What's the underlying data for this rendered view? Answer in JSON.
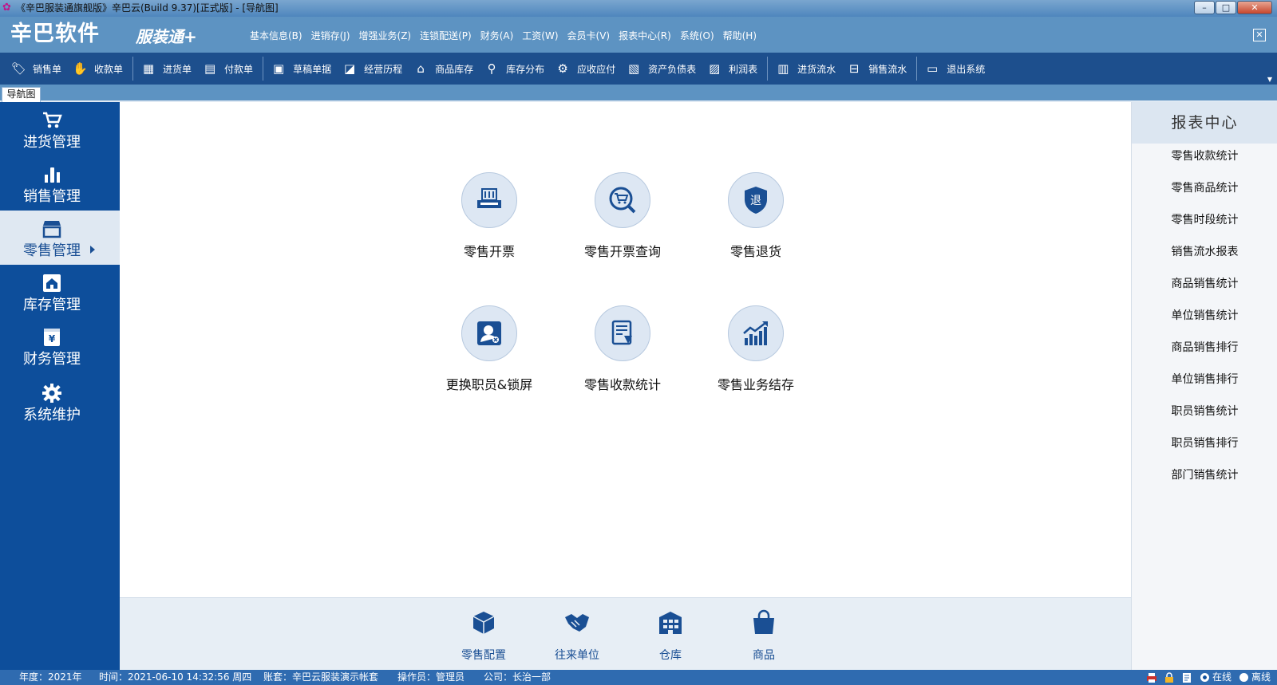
{
  "window": {
    "title": "《辛巴服装通旗舰版》辛巴云(Build 9.37)[正式版] - [导航图]",
    "buttons": {
      "minimize": "–",
      "maximize": "□",
      "close": "✕"
    }
  },
  "brand": {
    "logo": "辛巴软件",
    "product": "服装通+",
    "close": "✕"
  },
  "menu": [
    "基本信息(B)",
    "进销存(J)",
    "增强业务(Z)",
    "连锁配送(P)",
    "财务(A)",
    "工资(W)",
    "会员卡(V)",
    "报表中心(R)",
    "系统(O)",
    "帮助(H)"
  ],
  "toolbar": [
    {
      "label": "销售单",
      "icon": "tag-icon"
    },
    {
      "label": "收款单",
      "icon": "receive-money-icon"
    },
    {
      "label": "进货单",
      "icon": "calendar-icon"
    },
    {
      "label": "付款单",
      "icon": "payment-icon"
    },
    {
      "label": "草稿单据",
      "icon": "clipboard-icon"
    },
    {
      "label": "经营历程",
      "icon": "chart-line-icon"
    },
    {
      "label": "商品库存",
      "icon": "store-icon"
    },
    {
      "label": "库存分布",
      "icon": "map-pin-icon"
    },
    {
      "label": "应收应付",
      "icon": "settlement-icon"
    },
    {
      "label": "资产负债表",
      "icon": "balance-sheet-icon"
    },
    {
      "label": "利润表",
      "icon": "profit-icon"
    },
    {
      "label": "进货流水",
      "icon": "document-icon"
    },
    {
      "label": "销售流水",
      "icon": "basket-icon"
    },
    {
      "label": "退出系统",
      "icon": "monitor-icon"
    }
  ],
  "tabs": [
    {
      "label": "导航图"
    }
  ],
  "sidebar": [
    {
      "label": "进货管理",
      "icon": "cart-icon",
      "active": false
    },
    {
      "label": "销售管理",
      "icon": "bar-chart-icon",
      "active": false
    },
    {
      "label": "零售管理",
      "icon": "storefront-icon",
      "active": true
    },
    {
      "label": "库存管理",
      "icon": "warehouse-icon",
      "active": false
    },
    {
      "label": "财务管理",
      "icon": "yen-icon",
      "active": false
    },
    {
      "label": "系统维护",
      "icon": "gear-icon",
      "active": false
    }
  ],
  "functions": [
    {
      "label": "零售开票",
      "icon": "cash-register-icon"
    },
    {
      "label": "零售开票查询",
      "icon": "cart-search-icon"
    },
    {
      "label": "零售退货",
      "icon": "return-shield-icon"
    },
    {
      "label": "更换职员&锁屏",
      "icon": "user-switch-icon"
    },
    {
      "label": "零售收款统计",
      "icon": "report-icon"
    },
    {
      "label": "零售业务结存",
      "icon": "growth-chart-icon"
    }
  ],
  "quick": [
    {
      "label": "零售配置",
      "icon": "box-icon"
    },
    {
      "label": "往来单位",
      "icon": "handshake-icon"
    },
    {
      "label": "仓库",
      "icon": "warehouse-building-icon"
    },
    {
      "label": "商品",
      "icon": "shopping-bag-icon"
    }
  ],
  "report_center": {
    "title": "报表中心",
    "links": [
      "零售收款统计",
      "零售商品统计",
      "零售时段统计",
      "销售流水报表",
      "商品销售统计",
      "单位销售统计",
      "商品销售排行",
      "单位销售排行",
      "职员销售统计",
      "职员销售排行",
      "部门销售统计"
    ]
  },
  "status": {
    "year": "年度：2021年",
    "time": "时间：2021-06-10 14:32:56 周四",
    "account": "账套：辛巴云服装演示帐套",
    "operator": "操作员：管理员",
    "company": "公司：长治一部",
    "online": "在线",
    "offline": "离线"
  },
  "colors": {
    "sidebar": "#0d4e9b",
    "toolbar": "#1d4f8d",
    "brandbar": "#5d93c2",
    "icon_blue": "#1a4f94"
  }
}
